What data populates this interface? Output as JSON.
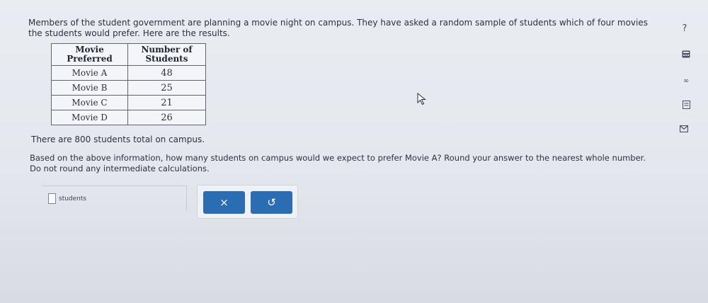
{
  "problem": {
    "intro": "Members of the student government are planning a movie night on campus. They have asked a random sample of students which of four movies the students would prefer. Here are the results."
  },
  "table": {
    "headers": [
      "Movie Preferred",
      "Number of Students"
    ],
    "rows": [
      {
        "movie": "Movie A",
        "count": "48"
      },
      {
        "movie": "Movie B",
        "count": "25"
      },
      {
        "movie": "Movie C",
        "count": "21"
      },
      {
        "movie": "Movie D",
        "count": "26"
      }
    ]
  },
  "total_statement": "There are 800 students total on campus.",
  "question": "Based on the above information, how many students on campus would we expect to prefer Movie A? Round your answer to the nearest whole number. Do not round any intermediate calculations.",
  "answer": {
    "value": "",
    "unit": "students"
  },
  "buttons": {
    "clear_label": "×",
    "undo_label": "↺"
  },
  "side_tools": {
    "help_label": "?",
    "infinity_label": "∞"
  },
  "colors": {
    "button_blue": "#2a6db3",
    "background": "#e6eaef"
  }
}
